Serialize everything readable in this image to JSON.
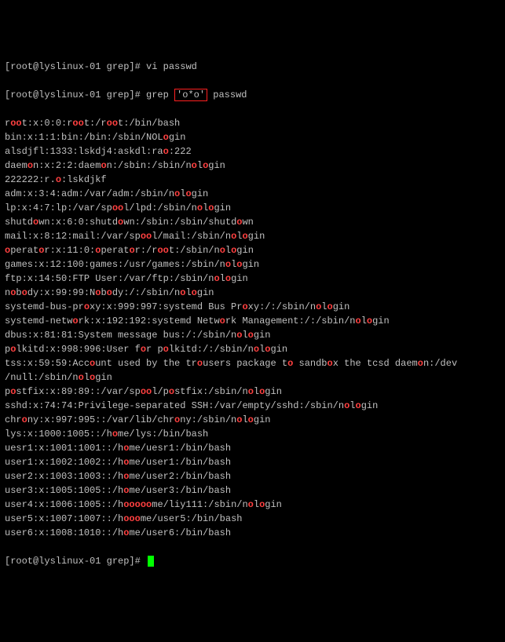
{
  "prompt1": "[root@lyslinux-01 grep]# vi passwd",
  "prompt2_pre": "[root@lyslinux-01 grep]# grep ",
  "prompt2_arg": "'o*o'",
  "prompt2_post": " passwd",
  "lines": [
    [
      [
        "r",
        1
      ],
      [
        "oo",
        2
      ],
      [
        "t:x:0:0:r",
        1
      ],
      [
        "oo",
        2
      ],
      [
        "t:/r",
        1
      ],
      [
        "oo",
        2
      ],
      [
        "t:/bin/bash",
        1
      ]
    ],
    [
      [
        "bin:x:1:1:bin:/bin:/sbin/NOL",
        1
      ],
      [
        "o",
        2
      ],
      [
        "gin",
        1
      ]
    ],
    [
      [
        "alsdjfl:1333:lskdj4:askdl:ra",
        1
      ],
      [
        "o",
        2
      ],
      [
        ":222",
        1
      ]
    ],
    [
      [
        "daem",
        1
      ],
      [
        "o",
        2
      ],
      [
        "n:x:2:2:daem",
        1
      ],
      [
        "o",
        2
      ],
      [
        "n:/sbin:/sbin/n",
        1
      ],
      [
        "o",
        2
      ],
      [
        "l",
        1
      ],
      [
        "o",
        2
      ],
      [
        "gin",
        1
      ]
    ],
    [
      [
        "222222:r.",
        1
      ],
      [
        "o",
        2
      ],
      [
        ":lskdjkf",
        1
      ]
    ],
    [
      [
        "adm:x:3:4:adm:/var/adm:/sbin/n",
        1
      ],
      [
        "o",
        2
      ],
      [
        "l",
        1
      ],
      [
        "o",
        2
      ],
      [
        "gin",
        1
      ]
    ],
    [
      [
        "lp:x:4:7:lp:/var/sp",
        1
      ],
      [
        "oo",
        2
      ],
      [
        "l/lpd:/sbin/n",
        1
      ],
      [
        "o",
        2
      ],
      [
        "l",
        1
      ],
      [
        "o",
        2
      ],
      [
        "gin",
        1
      ]
    ],
    [
      [
        "shutd",
        1
      ],
      [
        "o",
        2
      ],
      [
        "wn:x:6:0:shutd",
        1
      ],
      [
        "o",
        2
      ],
      [
        "wn:/sbin:/sbin/shutd",
        1
      ],
      [
        "o",
        2
      ],
      [
        "wn",
        1
      ]
    ],
    [
      [
        "mail:x:8:12:mail:/var/sp",
        1
      ],
      [
        "oo",
        2
      ],
      [
        "l/mail:/sbin/n",
        1
      ],
      [
        "o",
        2
      ],
      [
        "l",
        1
      ],
      [
        "o",
        2
      ],
      [
        "gin",
        1
      ]
    ],
    [
      [
        "o",
        2
      ],
      [
        "perat",
        1
      ],
      [
        "o",
        2
      ],
      [
        "r:x:11:0:",
        1
      ],
      [
        "o",
        2
      ],
      [
        "perat",
        1
      ],
      [
        "o",
        2
      ],
      [
        "r:/r",
        1
      ],
      [
        "oo",
        2
      ],
      [
        "t:/sbin/n",
        1
      ],
      [
        "o",
        2
      ],
      [
        "l",
        1
      ],
      [
        "o",
        2
      ],
      [
        "gin",
        1
      ]
    ],
    [
      [
        "games:x:12:100:games:/usr/games:/sbin/n",
        1
      ],
      [
        "o",
        2
      ],
      [
        "l",
        1
      ],
      [
        "o",
        2
      ],
      [
        "gin",
        1
      ]
    ],
    [
      [
        "ftp:x:14:50:FTP User:/var/ftp:/sbin/n",
        1
      ],
      [
        "o",
        2
      ],
      [
        "l",
        1
      ],
      [
        "o",
        2
      ],
      [
        "gin",
        1
      ]
    ],
    [
      [
        "n",
        1
      ],
      [
        "o",
        2
      ],
      [
        "b",
        1
      ],
      [
        "o",
        2
      ],
      [
        "dy:x:99:99:N",
        1
      ],
      [
        "o",
        2
      ],
      [
        "b",
        1
      ],
      [
        "o",
        2
      ],
      [
        "dy:/:/sbin/n",
        1
      ],
      [
        "o",
        2
      ],
      [
        "l",
        1
      ],
      [
        "o",
        2
      ],
      [
        "gin",
        1
      ]
    ],
    [
      [
        "systemd-bus-pr",
        1
      ],
      [
        "o",
        2
      ],
      [
        "xy:x:999:997:systemd Bus Pr",
        1
      ],
      [
        "o",
        2
      ],
      [
        "xy:/:/sbin/n",
        1
      ],
      [
        "o",
        2
      ],
      [
        "l",
        1
      ],
      [
        "o",
        2
      ],
      [
        "gin",
        1
      ]
    ],
    [
      [
        "systemd-netw",
        1
      ],
      [
        "o",
        2
      ],
      [
        "rk:x:192:192:systemd Netw",
        1
      ],
      [
        "o",
        2
      ],
      [
        "rk Management:/:/sbin/n",
        1
      ],
      [
        "o",
        2
      ],
      [
        "l",
        1
      ],
      [
        "o",
        2
      ],
      [
        "gin",
        1
      ]
    ],
    [
      [
        "dbus:x:81:81:System message bus:/:/sbin/n",
        1
      ],
      [
        "o",
        2
      ],
      [
        "l",
        1
      ],
      [
        "o",
        2
      ],
      [
        "gin",
        1
      ]
    ],
    [
      [
        "p",
        1
      ],
      [
        "o",
        2
      ],
      [
        "lkitd:x:998:996:User f",
        1
      ],
      [
        "o",
        2
      ],
      [
        "r p",
        1
      ],
      [
        "o",
        2
      ],
      [
        "lkitd:/:/sbin/n",
        1
      ],
      [
        "o",
        2
      ],
      [
        "l",
        1
      ],
      [
        "o",
        2
      ],
      [
        "gin",
        1
      ]
    ],
    [
      [
        "tss:x:59:59:Acc",
        1
      ],
      [
        "o",
        2
      ],
      [
        "unt used by the tr",
        1
      ],
      [
        "o",
        2
      ],
      [
        "users package t",
        1
      ],
      [
        "o",
        2
      ],
      [
        " sandb",
        1
      ],
      [
        "o",
        2
      ],
      [
        "x the tcsd daem",
        1
      ],
      [
        "o",
        2
      ],
      [
        "n:/dev",
        1
      ]
    ],
    [
      [
        "/null:/sbin/n",
        1
      ],
      [
        "o",
        2
      ],
      [
        "l",
        1
      ],
      [
        "o",
        2
      ],
      [
        "gin",
        1
      ]
    ],
    [
      [
        "p",
        1
      ],
      [
        "o",
        2
      ],
      [
        "stfix:x:89:89::/var/sp",
        1
      ],
      [
        "oo",
        2
      ],
      [
        "l/p",
        1
      ],
      [
        "o",
        2
      ],
      [
        "stfix:/sbin/n",
        1
      ],
      [
        "o",
        2
      ],
      [
        "l",
        1
      ],
      [
        "o",
        2
      ],
      [
        "gin",
        1
      ]
    ],
    [
      [
        "sshd:x:74:74:Privilege-separated SSH:/var/empty/sshd:/sbin/n",
        1
      ],
      [
        "o",
        2
      ],
      [
        "l",
        1
      ],
      [
        "o",
        2
      ],
      [
        "gin",
        1
      ]
    ],
    [
      [
        "chr",
        1
      ],
      [
        "o",
        2
      ],
      [
        "ny:x:997:995::/var/lib/chr",
        1
      ],
      [
        "o",
        2
      ],
      [
        "ny:/sbin/n",
        1
      ],
      [
        "o",
        2
      ],
      [
        "l",
        1
      ],
      [
        "o",
        2
      ],
      [
        "gin",
        1
      ]
    ],
    [
      [
        "lys:x:1000:1005::/h",
        1
      ],
      [
        "o",
        2
      ],
      [
        "me/lys:/bin/bash",
        1
      ]
    ],
    [
      [
        "uesr1:x:1001:1001::/h",
        1
      ],
      [
        "o",
        2
      ],
      [
        "me/uesr1:/bin/bash",
        1
      ]
    ],
    [
      [
        "user1:x:1002:1002::/h",
        1
      ],
      [
        "o",
        2
      ],
      [
        "me/user1:/bin/bash",
        1
      ]
    ],
    [
      [
        "user2:x:1003:1003::/h",
        1
      ],
      [
        "o",
        2
      ],
      [
        "me/user2:/bin/bash",
        1
      ]
    ],
    [
      [
        "user3:x:1005:1005::/h",
        1
      ],
      [
        "o",
        2
      ],
      [
        "me/user3:/bin/bash",
        1
      ]
    ],
    [
      [
        "user4:x:1006:1005::/h",
        1
      ],
      [
        "ooooo",
        2
      ],
      [
        "me/liy111:/sbin/n",
        1
      ],
      [
        "o",
        2
      ],
      [
        "l",
        1
      ],
      [
        "o",
        2
      ],
      [
        "gin",
        1
      ]
    ],
    [
      [
        "user5:x:1007:1007::/h",
        1
      ],
      [
        "ooo",
        2
      ],
      [
        "me/user5:/bin/bash",
        1
      ]
    ],
    [
      [
        "user6:x:1008:1010::/h",
        1
      ],
      [
        "o",
        2
      ],
      [
        "me/user6:/bin/bash",
        1
      ]
    ]
  ],
  "prompt3": "[root@lyslinux-01 grep]# "
}
